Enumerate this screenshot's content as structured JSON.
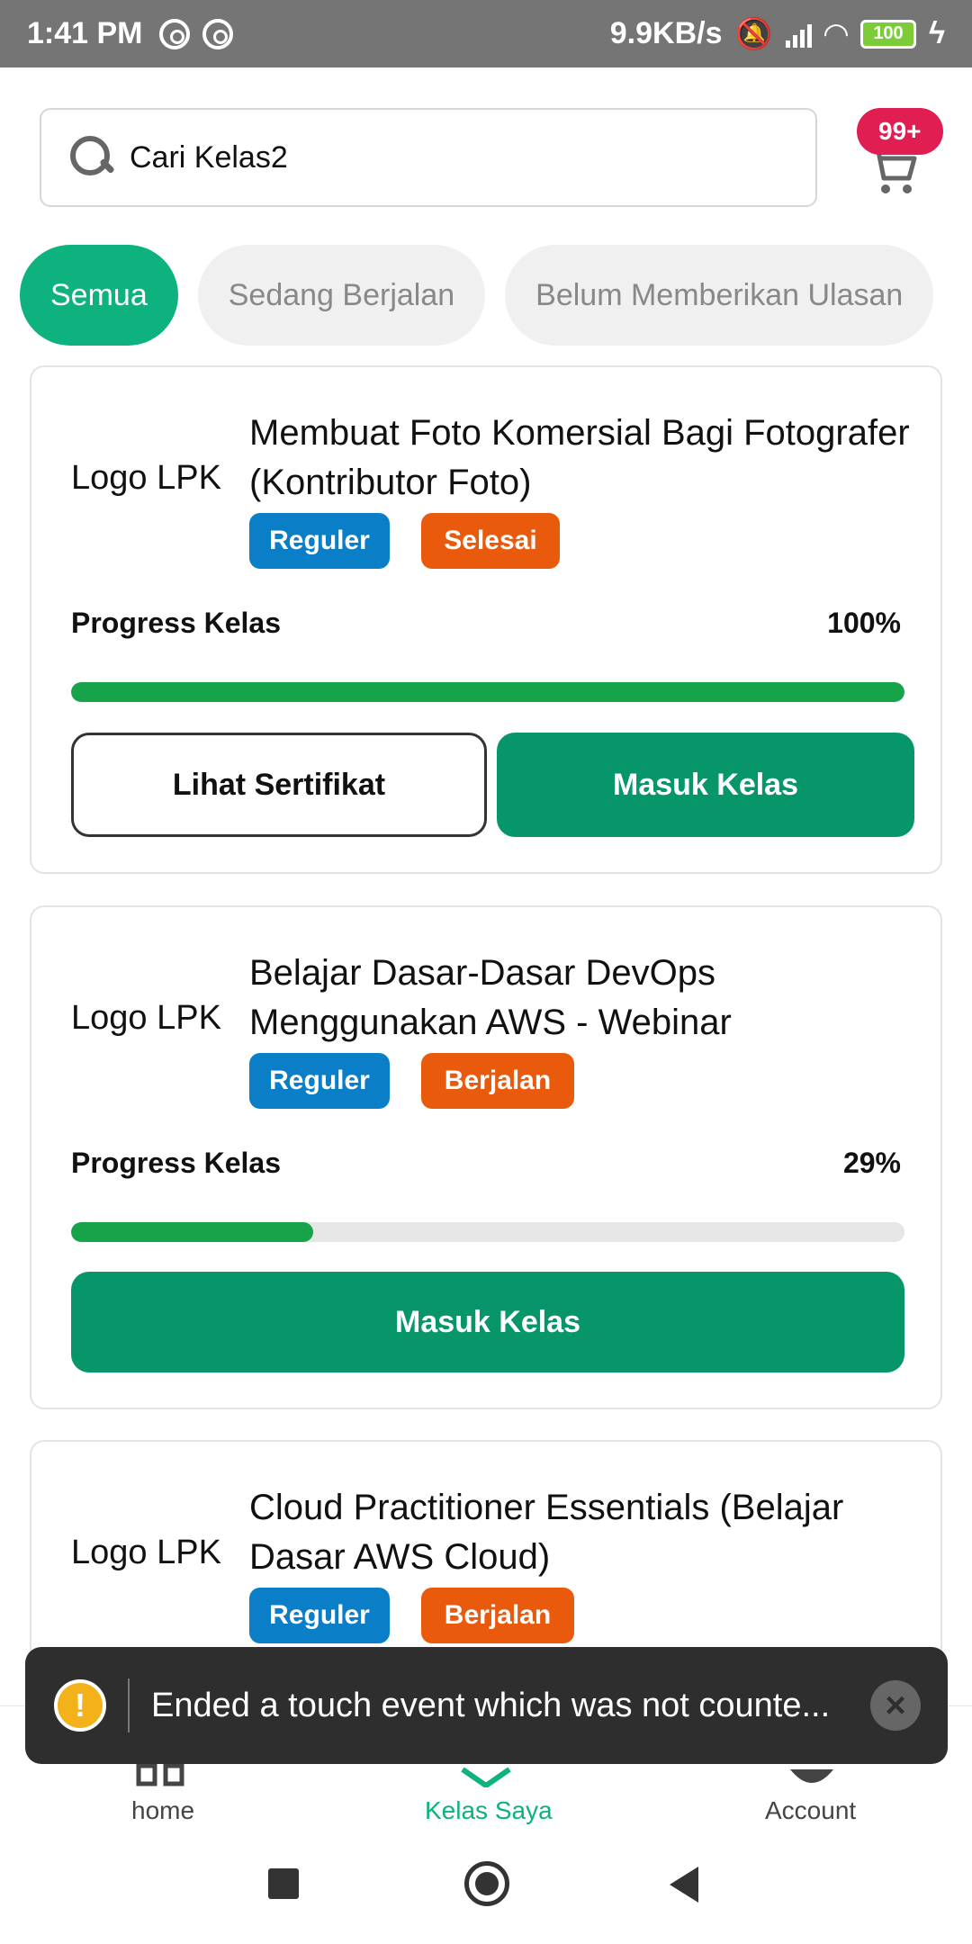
{
  "status_bar": {
    "time": "1:41 PM",
    "network_speed": "9.9KB/s",
    "battery": "100"
  },
  "search": {
    "value": "Cari Kelas2"
  },
  "cart": {
    "badge": "99+"
  },
  "tabs": [
    {
      "label": "Semua",
      "active": true
    },
    {
      "label": "Sedang Berjalan",
      "active": false
    },
    {
      "label": "Belum Memberikan Ulasan",
      "active": false
    }
  ],
  "courses": [
    {
      "logo": "Logo LPK",
      "title": "Membuat Foto Komersial Bagi Fotografer (Kontributor Foto)",
      "type_chip": "Reguler",
      "status_chip": "Selesai",
      "progress_label": "Progress Kelas",
      "progress_text": "100%",
      "progress_value": 1.0,
      "buttons": {
        "certificate": "Lihat Sertifikat",
        "enter": "Masuk Kelas"
      }
    },
    {
      "logo": "Logo LPK",
      "title": "Belajar Dasar-Dasar DevOps Menggunakan AWS - Webinar",
      "type_chip": "Reguler",
      "status_chip": "Berjalan",
      "progress_label": "Progress Kelas",
      "progress_text": "29%",
      "progress_value": 0.29,
      "buttons": {
        "enter": "Masuk Kelas"
      }
    },
    {
      "logo": "Logo LPK",
      "title": "Cloud Practitioner Essentials (Belajar Dasar AWS Cloud)",
      "type_chip": "Reguler",
      "status_chip": "Berjalan"
    }
  ],
  "bottom_nav": {
    "items": [
      {
        "label": "home",
        "icon": "home-icon"
      },
      {
        "label": "Kelas Saya",
        "icon": "class-icon",
        "active": true
      },
      {
        "label": "Account",
        "icon": "account-icon"
      }
    ]
  },
  "toast": {
    "message": "Ended a touch event which was not counte..."
  },
  "colors": {
    "brand": "#0db27e",
    "primary_button": "#06966a",
    "chip_blue": "#0a7fc8",
    "chip_orange": "#ea5a0c",
    "badge": "#e01e52"
  }
}
